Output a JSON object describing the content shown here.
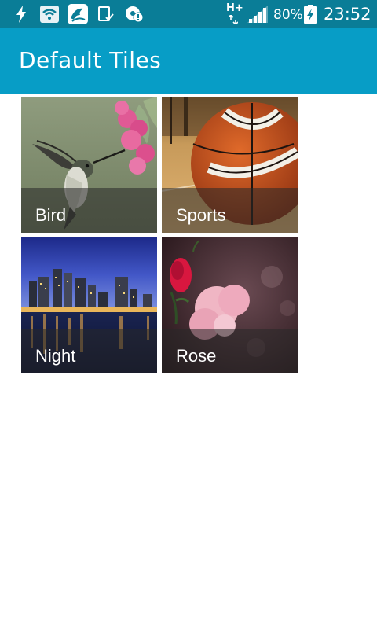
{
  "status_bar": {
    "icons": [
      "flash-icon",
      "wifi-icon",
      "app-notification-icon",
      "task-icon",
      "alert-icon"
    ],
    "network": "H+",
    "battery_percent": "80%",
    "time": "23:52"
  },
  "app_bar": {
    "title": "Default Tiles"
  },
  "tiles": [
    {
      "label": "Bird"
    },
    {
      "label": "Sports"
    },
    {
      "label": "Night"
    },
    {
      "label": "Rose"
    }
  ]
}
